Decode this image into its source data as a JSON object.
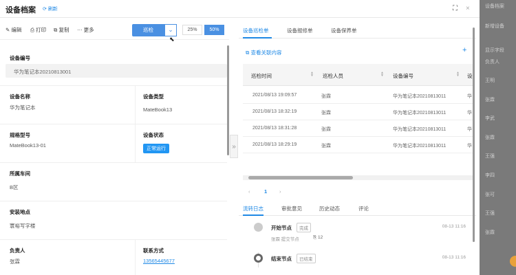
{
  "header": {
    "title": "设备档案",
    "refresh_label": "刷新",
    "fullscreen_icon": "⛶",
    "close_icon": "×"
  },
  "toolbar": {
    "edit_label": "编辑",
    "print_label": "打印",
    "copy_label": "复制",
    "more_label": "更多",
    "inspect_label": "巡检",
    "dropdown_icon": "⌄",
    "zoom_25": "25%",
    "zoom_50": "50%"
  },
  "form": {
    "device_no_label": "设备编号",
    "device_no_value": "华为笔记本20210813001",
    "device_name_label": "设备名称",
    "device_name_value": "华为笔记本",
    "device_type_label": "设备类型",
    "device_type_value": "MateBook13",
    "model_label": "规格型号",
    "model_value": "MateBook13-01",
    "status_label": "设备状态",
    "status_value": "正常运行",
    "workshop_label": "所属车间",
    "workshop_value": "B区",
    "location_label": "安装地点",
    "location_value": "寰裕写字楼",
    "owner_label": "负责人",
    "owner_value": "张霖",
    "contact_label": "联系方式",
    "contact_value": "13565445677"
  },
  "right": {
    "tabs": [
      "设备巡检单",
      "设备报修单",
      "设备保养单"
    ],
    "view_link": "查看关联内容",
    "columns": [
      "巡检时间",
      "巡检人员",
      "设备编号",
      "设"
    ],
    "rows": [
      [
        "2021/08/13 19:09:57",
        "张霖",
        "华为笔记本20210813011",
        "华"
      ],
      [
        "2021/08/13 18:32:19",
        "张霖",
        "华为笔记本20210813011",
        "华"
      ],
      [
        "2021/08/13 18:31:28",
        "张霖",
        "华为笔记本20210813011",
        "华"
      ],
      [
        "2021/08/13 18:29:19",
        "张霖",
        "华为笔记本20210813011",
        "华"
      ]
    ],
    "pager": {
      "prev": "‹",
      "current": "1",
      "next": "›"
    },
    "log_tabs": [
      "流转日志",
      "审批意见",
      "历史动态",
      "评论"
    ],
    "nodes": [
      {
        "title": "开始节点",
        "tag": "完成",
        "time": "08-13 11:16",
        "sub": "张霖 提交节点",
        "count": "12"
      },
      {
        "title": "结束节点",
        "tag": "已结束",
        "time": "08-13 11:16"
      }
    ]
  },
  "background": {
    "items": [
      "设备档案",
      "新增设备",
      "显示字段",
      "负责人",
      "王明",
      "张霖",
      "李武",
      "张霖",
      "王强",
      "李四",
      "张可",
      "王强",
      "张霖"
    ]
  }
}
